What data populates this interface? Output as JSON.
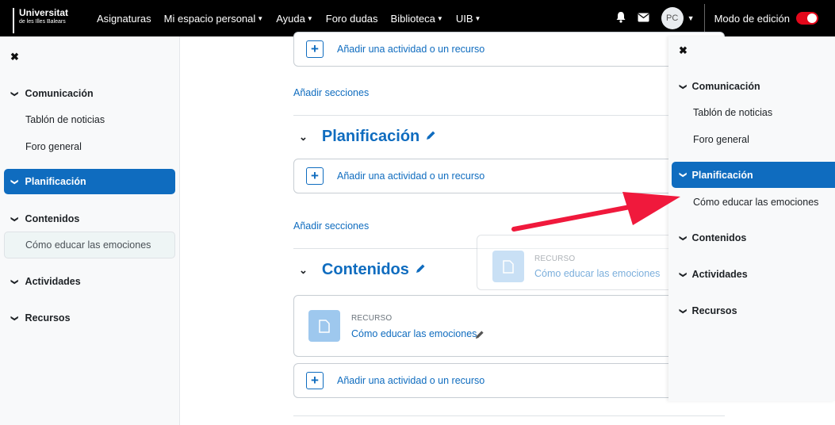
{
  "navbar": {
    "logo_main": "Universitat",
    "logo_sub": "de les Illes Balears",
    "menu": [
      {
        "label": "Asignaturas",
        "dropdown": false
      },
      {
        "label": "Mi espacio personal",
        "dropdown": true
      },
      {
        "label": "Ayuda",
        "dropdown": true
      },
      {
        "label": "Foro dudas",
        "dropdown": false
      },
      {
        "label": "Biblioteca",
        "dropdown": true
      },
      {
        "label": "UIB",
        "dropdown": true
      }
    ],
    "icons": [
      "bell-icon",
      "message-icon"
    ],
    "avatar_initials": "PC",
    "edit_mode_label": "Modo de edición",
    "edit_mode_on": true,
    "toggle_color": "#e3081b"
  },
  "left_index": {
    "items": [
      {
        "label": "Comunicación",
        "type": "section"
      },
      {
        "label": "Tablón de noticias",
        "type": "activity"
      },
      {
        "label": "Foro general",
        "type": "activity"
      },
      {
        "label": "Planificación",
        "type": "section",
        "active": true
      },
      {
        "label": "Contenidos",
        "type": "section"
      },
      {
        "label": "Cómo educar las emociones",
        "type": "activity",
        "current": true
      },
      {
        "label": "Actividades",
        "type": "section"
      },
      {
        "label": "Recursos",
        "type": "section"
      }
    ]
  },
  "main": {
    "add_activity_label": "Añadir una actividad o un recurso",
    "add_sections_label": "Añadir secciones",
    "sections": [
      {
        "title": "Planificación"
      },
      {
        "title": "Contenidos"
      }
    ],
    "resource": {
      "type_label": "RECURSO",
      "name": "Cómo educar las emociones",
      "icon": "file-icon"
    }
  },
  "right_index": {
    "items": [
      {
        "label": "Comunicación",
        "type": "section"
      },
      {
        "label": "Tablón de noticias",
        "type": "activity"
      },
      {
        "label": "Foro general",
        "type": "activity"
      },
      {
        "label": "Planificación",
        "type": "section",
        "active": true
      },
      {
        "label": "Cómo educar las emociones",
        "type": "activity"
      },
      {
        "label": "Contenidos",
        "type": "section"
      },
      {
        "label": "Actividades",
        "type": "section"
      },
      {
        "label": "Recursos",
        "type": "section"
      }
    ]
  },
  "colors": {
    "brand_blue": "#0f6cbf",
    "annotation_arrow": "#f0193c"
  }
}
